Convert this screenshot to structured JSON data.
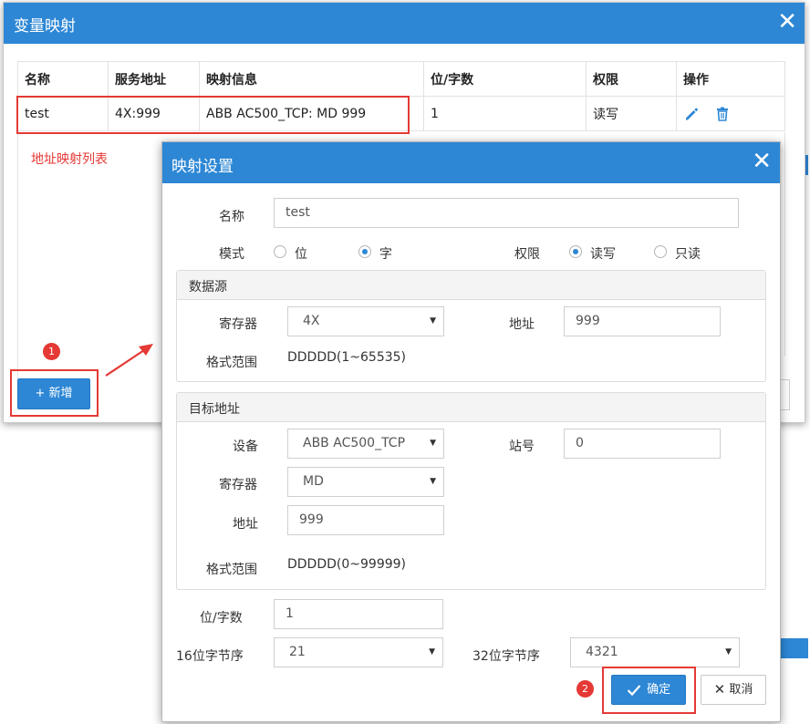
{
  "outer_dialog": {
    "title": "变量映射",
    "close": "✕",
    "table": {
      "headers": [
        "名称",
        "服务地址",
        "映射信息",
        "位/字数",
        "权限",
        "操作"
      ],
      "rows": [
        {
          "name": "test",
          "service_address": "4X:999",
          "mapping_info": "ABB AC500_TCP: MD 999",
          "bits_words": "1",
          "permission": "读写"
        }
      ]
    },
    "annotation_text": "地址映射列表",
    "add_button_label": "+ 新增",
    "badge_1": "1"
  },
  "inner_dialog": {
    "title": "映射设置",
    "close": "✕",
    "name_label": "名称",
    "name_value": "test",
    "mode_label": "模式",
    "mode_options": [
      "位",
      "字"
    ],
    "mode_selected": "字",
    "permission_label": "权限",
    "permission_options": [
      "读写",
      "只读"
    ],
    "permission_selected": "读写",
    "source": {
      "title": "数据源",
      "register_label": "寄存器",
      "register_value": "4X",
      "address_label": "地址",
      "address_value": "999",
      "format_label": "格式范围",
      "format_value": "DDDDD(1~65535)"
    },
    "target": {
      "title": "目标地址",
      "device_label": "设备",
      "device_value": "ABB AC500_TCP",
      "station_label": "站号",
      "station_value": "0",
      "register_label": "寄存器",
      "register_value": "MD",
      "address_label": "地址",
      "address_value": "999",
      "format_label": "格式范围",
      "format_value": "DDDDD(0~99999)"
    },
    "bits_words_label": "位/字数",
    "bits_words_value": "1",
    "byte16_label": "16位字节序",
    "byte16_value": "21",
    "byte32_label": "32位字节序",
    "byte32_value": "4321",
    "confirm_label": "确定",
    "cancel_label": "取消",
    "badge_2": "2"
  },
  "colors": {
    "accent": "#2d87d5",
    "annotation": "#e53935"
  }
}
